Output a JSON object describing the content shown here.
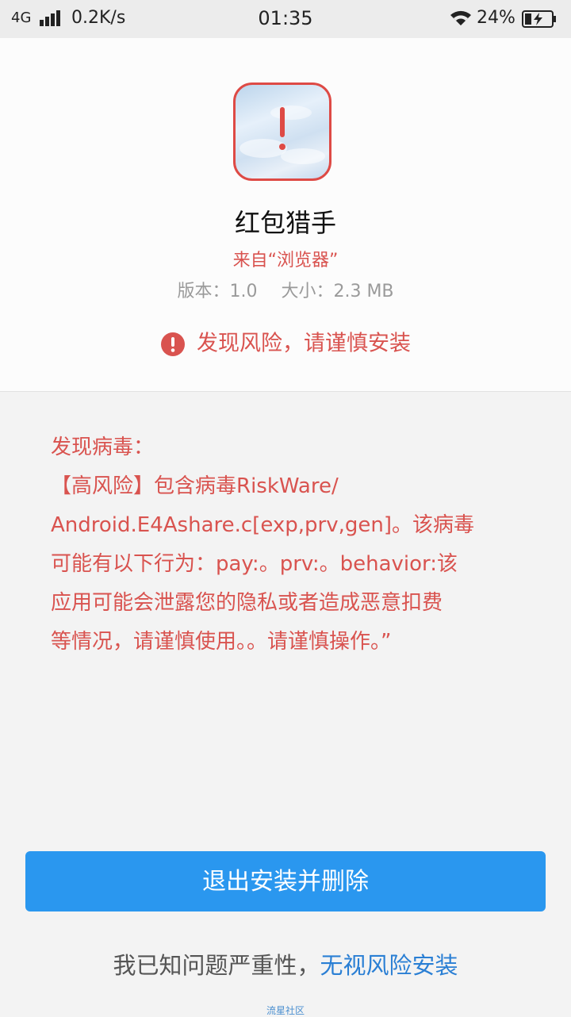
{
  "status_bar": {
    "network": "4G",
    "speed": "0.2K/s",
    "time": "01:35",
    "battery": "24%",
    "icons": [
      "signal-icon",
      "wifi-icon",
      "battery-charging-icon"
    ]
  },
  "app": {
    "name": "红包猎手",
    "source": "来自“浏览器”",
    "version": "版本：1.0",
    "size": "大小：2.3 MB",
    "risk_notice": "发现风险，请谨慎安装"
  },
  "virus": {
    "lines": [
      "发现病毒：",
      "【高风险】包含病毒RiskWare/",
      "Android.E4Ashare.c[exp,prv,gen]。该病毒",
      "可能有以下行为：pay:。prv:。behavior:该",
      "应用可能会泄露您的隐私或者造成恶意扣费",
      "等情况，请谨慎使用。。请谨慎操作。”"
    ]
  },
  "actions": {
    "exit_label": "退出安装并删除",
    "ignore_prefix": "我已知问题严重性，",
    "ignore_link": "无视风险安装"
  },
  "watermark": "流星社区",
  "colors": {
    "warning_red": "#d9534f",
    "primary_blue": "#2a97ef",
    "link_blue": "#2a7fd4"
  }
}
